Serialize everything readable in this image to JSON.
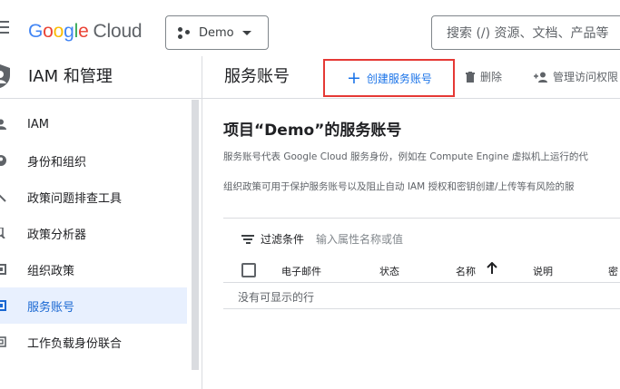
{
  "header": {
    "logo_google": "Google",
    "logo_cloud": "Cloud",
    "project_name": "Demo",
    "search_placeholder": "搜索 (/) 资源、文档、产品等"
  },
  "product": {
    "title": "IAM 和管理"
  },
  "page": {
    "title": "服务账号",
    "create_label": "创建服务账号",
    "delete_label": "删除",
    "manage_label": "管理访问权限"
  },
  "sidebar": {
    "items": [
      {
        "label": "IAM",
        "icon": "person-icon",
        "active": false
      },
      {
        "label": "身份和组织",
        "icon": "person-circle-icon",
        "active": false
      },
      {
        "label": "政策问题排查工具",
        "icon": "wrench-icon",
        "active": false
      },
      {
        "label": "政策分析器",
        "icon": "analyzer-icon",
        "active": false
      },
      {
        "label": "组织政策",
        "icon": "document-icon",
        "active": false
      },
      {
        "label": "服务账号",
        "icon": "service-account-icon",
        "active": true
      },
      {
        "label": "工作负载身份联合",
        "icon": "workload-icon",
        "active": false
      }
    ]
  },
  "main": {
    "heading": "项目“Demo”的服务账号",
    "desc1": "服务账号代表 Google Cloud 服务身份，例如在 Compute Engine 虚拟机上运行的代",
    "desc2": "组织政策可用于保护服务账号以及阻止自动 IAM 授权和密钥创建/上传等有风险的服",
    "filter_label": "过滤条件",
    "filter_placeholder": "输入属性名称或值",
    "columns": [
      "电子邮件",
      "状态",
      "名称",
      "说明",
      "密"
    ],
    "empty_text": "没有可显示的行"
  },
  "colors": {
    "accent": "#1a73e8",
    "highlight_border": "#e53935",
    "active_bg": "#e8f0fe"
  }
}
